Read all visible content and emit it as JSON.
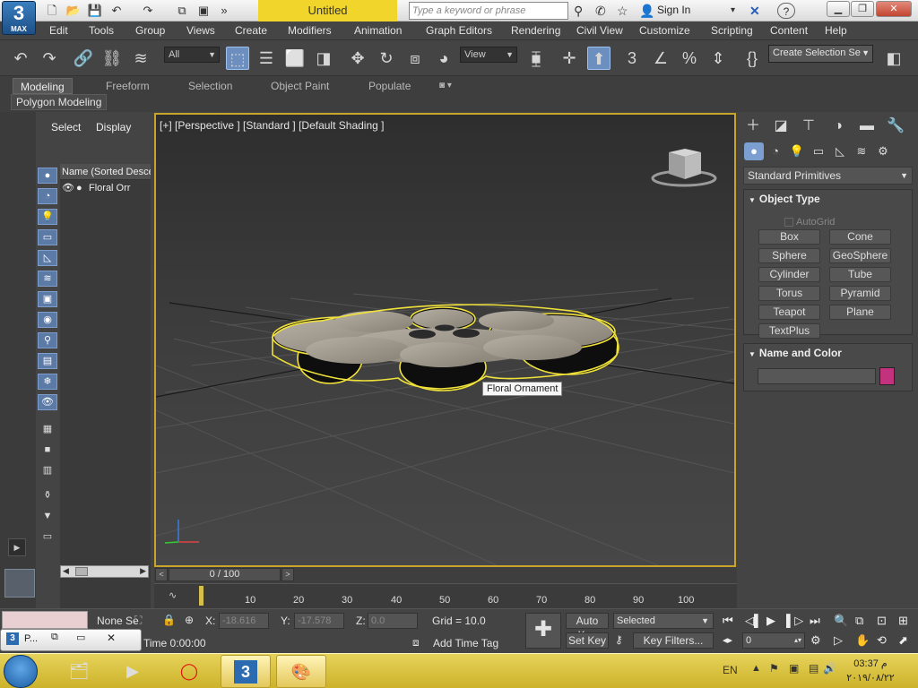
{
  "app": {
    "logo_text": "3",
    "logo_sub": "MAX",
    "doc_title": "Untitled",
    "search_placeholder": "Type a keyword or phrase",
    "sign_in": "Sign In"
  },
  "menu": [
    "Edit",
    "Tools",
    "Group",
    "Views",
    "Create",
    "Modifiers",
    "Animation",
    "Graph Editors",
    "Rendering",
    "Civil View",
    "Customize",
    "Scripting",
    "Content",
    "Help"
  ],
  "toolbar": {
    "selection_filter": "All",
    "ref_coord": "View",
    "named_selection": "Create Selection Se"
  },
  "ribbon": {
    "tabs": [
      "Modeling",
      "Freeform",
      "Selection",
      "Object Paint",
      "Populate"
    ],
    "active_tab": "Modeling",
    "sub_panel": "Polygon Modeling"
  },
  "scene_explorer": {
    "tabs": [
      "Select",
      "Display"
    ],
    "column_header": "Name (Sorted Desce",
    "rows": [
      "Floral Orr"
    ]
  },
  "viewport": {
    "label": "[+] [Perspective ] [Standard ] [Default Shading ]",
    "tooltip": "Floral Ornament"
  },
  "command_panel": {
    "category": "Standard Primitives",
    "object_type_title": "Object Type",
    "autogrid": "AutoGrid",
    "primitives": [
      "Box",
      "Cone",
      "Sphere",
      "GeoSphere",
      "Cylinder",
      "Tube",
      "Torus",
      "Pyramid",
      "Teapot",
      "Plane",
      "TextPlus"
    ],
    "name_color_title": "Name and Color",
    "object_color": "#c2327d"
  },
  "timeline": {
    "frame_readout": "0 / 100",
    "ticks": [
      "10",
      "20",
      "30",
      "40",
      "50",
      "60",
      "70",
      "80",
      "90",
      "100"
    ]
  },
  "status": {
    "selection_set": "None Se",
    "minimized_label": "P...",
    "x_label": "X:",
    "x_value": "-18.616",
    "y_label": "Y:",
    "y_value": "-17.578",
    "z_label": "Z:",
    "z_value": "0.0",
    "grid": "Grid = 10.0",
    "time": "Time  0:00:00",
    "add_time_tag": "Add Time Tag",
    "auto_key": "Auto Key",
    "set_key": "Set Key",
    "key_mode": "Selected",
    "key_filters": "Key Filters...",
    "current_frame": "0"
  },
  "taskbar": {
    "language": "EN",
    "clock_time": "03:37 م",
    "clock_date": "٢٠١٩/٠٨/٢٢"
  }
}
